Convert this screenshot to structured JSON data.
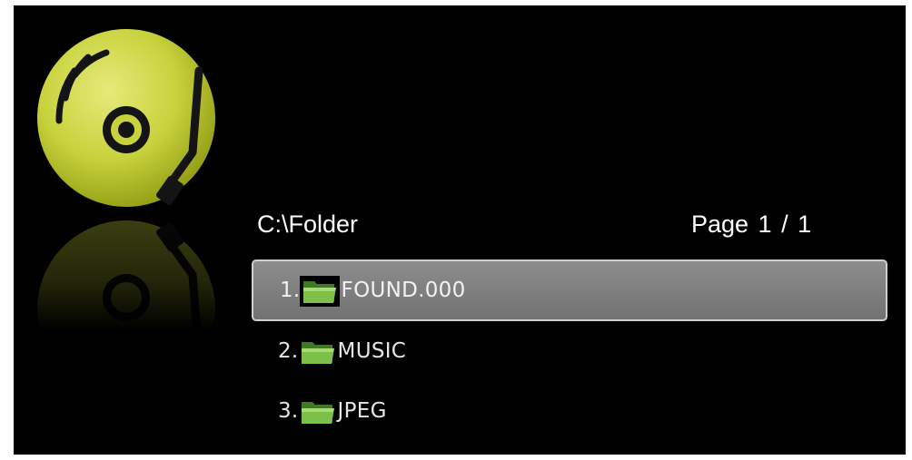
{
  "header": {
    "path": "C:\\Folder",
    "page_indicator": "Page  1 / 1"
  },
  "files": [
    {
      "index": "1.",
      "name": "FOUND.000",
      "icon": "folder-icon",
      "selected": true
    },
    {
      "index": "2.",
      "name": "MUSIC",
      "icon": "folder-icon",
      "selected": false
    },
    {
      "index": "3.",
      "name": "JPEG",
      "icon": "folder-icon",
      "selected": false
    }
  ],
  "colors": {
    "background": "#000000",
    "disc": "#c4d43a",
    "selection": "#808080",
    "folder": "#6fae3f"
  },
  "logo": {
    "icon": "music-disc-icon"
  }
}
